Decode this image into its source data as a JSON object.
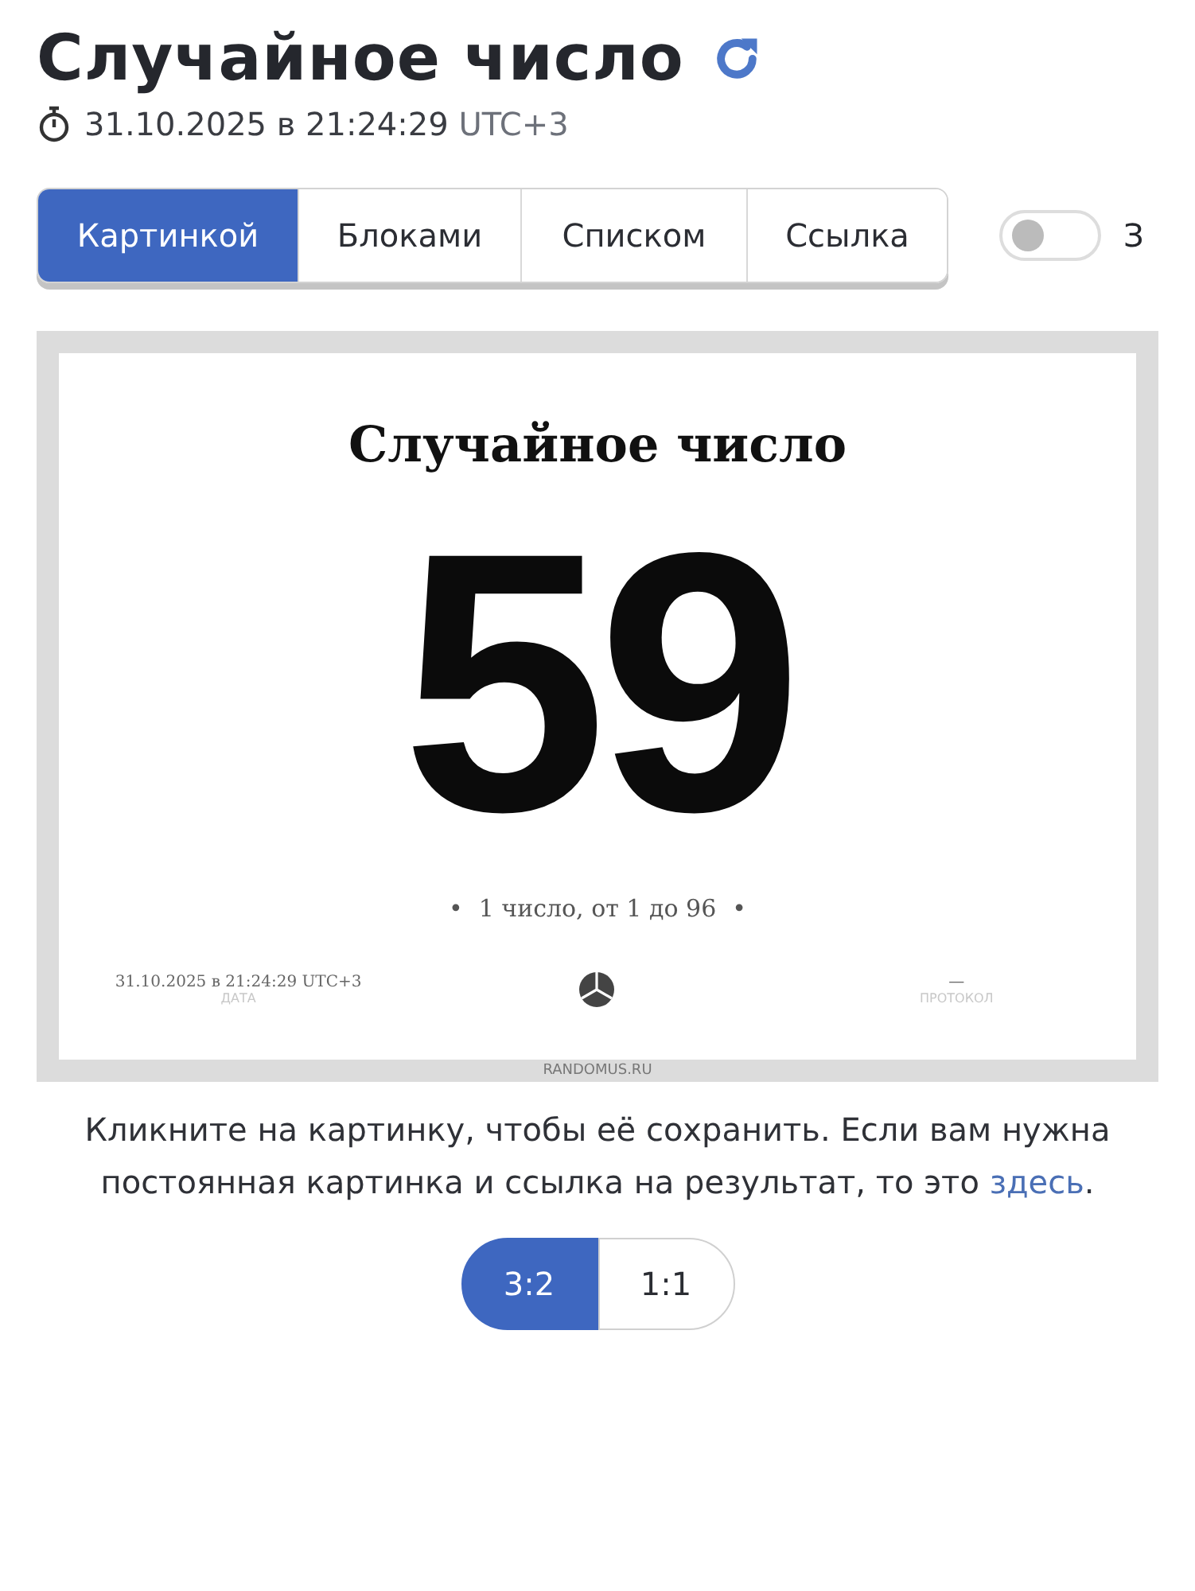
{
  "header": {
    "title": "Случайное число",
    "date": "31.10.2025 в 21:24:29",
    "timezone": "UTC+3"
  },
  "tabs": [
    {
      "label": "Картинкой",
      "selected": true
    },
    {
      "label": "Блоками",
      "selected": false
    },
    {
      "label": "Списком",
      "selected": false
    },
    {
      "label": "Ссылка",
      "selected": false
    }
  ],
  "toggle": {
    "on": false,
    "label": "З"
  },
  "card": {
    "title": "Случайное число",
    "number": "59",
    "subtitle": "1 число, от 1 до 96",
    "bullet": "•",
    "date": "31.10.2025 в 21:24:29 UTC+3",
    "date_label": "ДАТА",
    "protocol": "—",
    "protocol_label": "ПРОТОКОЛ",
    "site": "RANDOMUS.RU"
  },
  "caption": {
    "text": "Кликните на картинку, чтобы её сохранить. Если вам нужна постоянная картинка и ссылка на результат, то это",
    "link": "здесь",
    "end": "."
  },
  "ratios": [
    {
      "label": "3:2",
      "selected": true
    },
    {
      "label": "1:1",
      "selected": false
    }
  ]
}
